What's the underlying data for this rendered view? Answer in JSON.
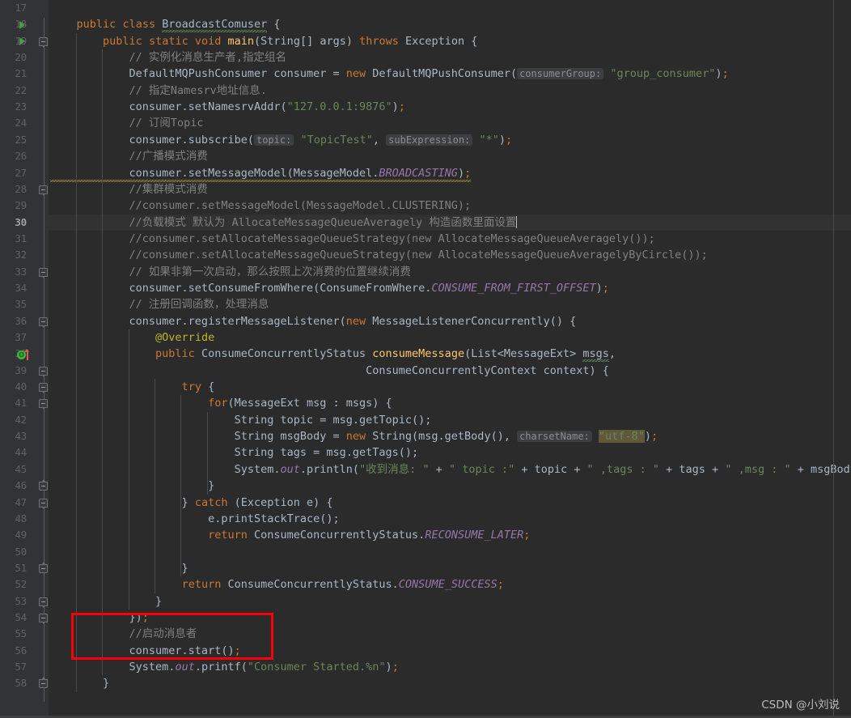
{
  "editor": {
    "theme": "darcula",
    "background": "#2b2b2b",
    "gutter_background": "#313335",
    "current_line_number": 30,
    "first_visible_line": 17,
    "last_visible_line": 58,
    "language": "Java",
    "caret_line": 30
  },
  "watermark": {
    "text": "CSDN @小刘说"
  },
  "annotation": {
    "color": "#fb0007",
    "covers_lines": "54-56",
    "label": "red-highlight-box"
  },
  "gutter": {
    "run_arrow_lines": [
      18,
      19
    ],
    "fold_start_lines": [
      19,
      28,
      33,
      36,
      39,
      40,
      41,
      47,
      53,
      54
    ],
    "fold_end_lines": [
      46,
      51,
      58
    ],
    "override_marker_lines": [
      38
    ],
    "override_marker_glyph": "O"
  },
  "lines": [
    {
      "n": 17,
      "tokens": []
    },
    {
      "n": 18,
      "tokens": [
        {
          "t": "    ",
          "c": "plain"
        },
        {
          "t": "public",
          "c": "kw"
        },
        {
          "t": " ",
          "c": "plain"
        },
        {
          "t": "class",
          "c": "kw"
        },
        {
          "t": " ",
          "c": "plain"
        },
        {
          "t": "BroadcastComuser",
          "c": "typo"
        },
        {
          "t": " {",
          "c": "plain"
        }
      ]
    },
    {
      "n": 19,
      "tokens": [
        {
          "t": "        ",
          "c": "plain"
        },
        {
          "t": "public",
          "c": "kw"
        },
        {
          "t": " ",
          "c": "plain"
        },
        {
          "t": "static",
          "c": "kw"
        },
        {
          "t": " ",
          "c": "plain"
        },
        {
          "t": "void",
          "c": "kw"
        },
        {
          "t": " ",
          "c": "plain"
        },
        {
          "t": "main",
          "c": "meth"
        },
        {
          "t": "(String[] args) ",
          "c": "plain"
        },
        {
          "t": "throws",
          "c": "kw"
        },
        {
          "t": " Exception {",
          "c": "plain"
        }
      ]
    },
    {
      "n": 20,
      "tokens": [
        {
          "t": "            // 实例化消息生产者,指定组名",
          "c": "cmt"
        }
      ]
    },
    {
      "n": 21,
      "tokens": [
        {
          "t": "            DefaultMQPushConsumer consumer = ",
          "c": "plain"
        },
        {
          "t": "new",
          "c": "kw"
        },
        {
          "t": " DefaultMQPushConsumer(",
          "c": "plain"
        },
        {
          "t": "consumerGroup:",
          "c": "hint"
        },
        {
          "t": " ",
          "c": "plain"
        },
        {
          "t": "\"group_consumer\"",
          "c": "str"
        },
        {
          "t": ")",
          "c": "plain"
        },
        {
          "t": ";",
          "c": "semi"
        }
      ]
    },
    {
      "n": 22,
      "tokens": [
        {
          "t": "            // 指定Namesrv地址信息.",
          "c": "cmt"
        }
      ]
    },
    {
      "n": 23,
      "tokens": [
        {
          "t": "            consumer.setNamesrvAddr(",
          "c": "plain"
        },
        {
          "t": "\"127.0.0.1:9876\"",
          "c": "str"
        },
        {
          "t": ")",
          "c": "plain"
        },
        {
          "t": ";",
          "c": "semi"
        }
      ]
    },
    {
      "n": 24,
      "tokens": [
        {
          "t": "            // 订阅Topic",
          "c": "cmt"
        }
      ]
    },
    {
      "n": 25,
      "tokens": [
        {
          "t": "            consumer.subscribe(",
          "c": "plain"
        },
        {
          "t": "topic:",
          "c": "hint"
        },
        {
          "t": " ",
          "c": "plain"
        },
        {
          "t": "\"TopicTest\"",
          "c": "str"
        },
        {
          "t": ", ",
          "c": "plain"
        },
        {
          "t": "subExpression:",
          "c": "hint"
        },
        {
          "t": " ",
          "c": "plain"
        },
        {
          "t": "\"*\"",
          "c": "str"
        },
        {
          "t": ")",
          "c": "plain"
        },
        {
          "t": ";",
          "c": "semi"
        }
      ]
    },
    {
      "n": 26,
      "tokens": [
        {
          "t": "            //广播模式消费",
          "c": "cmt"
        }
      ]
    },
    {
      "n": 27,
      "warn": true,
      "tokens": [
        {
          "t": "            consumer.setMessageModel(MessageModel.",
          "c": "plain"
        },
        {
          "t": "BROADCASTING",
          "c": "fld"
        },
        {
          "t": ")",
          "c": "plain"
        },
        {
          "t": ";",
          "c": "semi"
        }
      ]
    },
    {
      "n": 28,
      "tokens": [
        {
          "t": "            //集群模式消费",
          "c": "cmt"
        }
      ]
    },
    {
      "n": 29,
      "tokens": [
        {
          "t": "            //consumer.setMessageModel(MessageModel.CLUSTERING);",
          "c": "cmt"
        }
      ]
    },
    {
      "n": 30,
      "current": true,
      "caret": true,
      "tokens": [
        {
          "t": "            //负载模式 默认为 AllocateMessageQueueAveragely 构造函数里面设置",
          "c": "cmt"
        }
      ]
    },
    {
      "n": 31,
      "tokens": [
        {
          "t": "            //consumer.setAllocateMessageQueueStrategy(new AllocateMessageQueueAveragely());",
          "c": "cmt"
        }
      ]
    },
    {
      "n": 32,
      "tokens": [
        {
          "t": "            //consumer.setAllocateMessageQueueStrategy(new AllocateMessageQueueAveragelyByCircle());",
          "c": "cmt"
        }
      ]
    },
    {
      "n": 33,
      "tokens": [
        {
          "t": "            // 如果非第一次启动，那么按照上次消费的位置继续消费",
          "c": "cmt"
        }
      ]
    },
    {
      "n": 34,
      "tokens": [
        {
          "t": "            consumer.setConsumeFromWhere(ConsumeFromWhere.",
          "c": "plain"
        },
        {
          "t": "CONSUME_FROM_FIRST_OFFSET",
          "c": "fld"
        },
        {
          "t": ")",
          "c": "plain"
        },
        {
          "t": ";",
          "c": "semi"
        }
      ]
    },
    {
      "n": 35,
      "tokens": [
        {
          "t": "            // 注册回调函数，处理消息",
          "c": "cmt"
        }
      ]
    },
    {
      "n": 36,
      "tokens": [
        {
          "t": "            consumer.registerMessageListener(",
          "c": "plain"
        },
        {
          "t": "new",
          "c": "kw"
        },
        {
          "t": " MessageListenerConcurrently() {",
          "c": "plain"
        }
      ]
    },
    {
      "n": 37,
      "tokens": [
        {
          "t": "                ",
          "c": "plain"
        },
        {
          "t": "@Override",
          "c": "anno"
        }
      ]
    },
    {
      "n": 38,
      "tokens": [
        {
          "t": "                ",
          "c": "plain"
        },
        {
          "t": "public",
          "c": "kw"
        },
        {
          "t": " ConsumeConcurrentlyStatus ",
          "c": "plain"
        },
        {
          "t": "consumeMessage",
          "c": "meth"
        },
        {
          "t": "(List<MessageExt> ",
          "c": "plain"
        },
        {
          "t": "msgs",
          "c": "typo"
        },
        {
          "t": ",",
          "c": "plain"
        }
      ]
    },
    {
      "n": 39,
      "tokens": [
        {
          "t": "                                                ConsumeConcurrentlyContext context) {",
          "c": "plain"
        }
      ]
    },
    {
      "n": 40,
      "tokens": [
        {
          "t": "                    ",
          "c": "plain"
        },
        {
          "t": "try",
          "c": "kw"
        },
        {
          "t": " {",
          "c": "plain"
        }
      ]
    },
    {
      "n": 41,
      "tokens": [
        {
          "t": "                        ",
          "c": "plain"
        },
        {
          "t": "for",
          "c": "kw"
        },
        {
          "t": "(MessageExt msg : msgs) {",
          "c": "plain"
        }
      ]
    },
    {
      "n": 42,
      "tokens": [
        {
          "t": "                            String topic = msg.getTopic();",
          "c": "plain"
        }
      ]
    },
    {
      "n": 43,
      "tokens": [
        {
          "t": "                            String msgBody = ",
          "c": "plain"
        },
        {
          "t": "new",
          "c": "kw"
        },
        {
          "t": " String(msg.getBody(), ",
          "c": "plain"
        },
        {
          "t": "charsetName:",
          "c": "hint"
        },
        {
          "t": " ",
          "c": "plain"
        },
        {
          "t": "\"utf-8\"",
          "c": "str-sel"
        },
        {
          "t": ")",
          "c": "plain"
        },
        {
          "t": ";",
          "c": "semi"
        }
      ]
    },
    {
      "n": 44,
      "tokens": [
        {
          "t": "                            String tags = msg.getTags();",
          "c": "plain"
        }
      ]
    },
    {
      "n": 45,
      "tokens": [
        {
          "t": "                            System.",
          "c": "plain"
        },
        {
          "t": "out",
          "c": "fld"
        },
        {
          "t": ".println(",
          "c": "plain"
        },
        {
          "t": "\"收到消息: \"",
          "c": "str"
        },
        {
          "t": " + ",
          "c": "plain"
        },
        {
          "t": "\" topic :\"",
          "c": "str"
        },
        {
          "t": " + topic + ",
          "c": "plain"
        },
        {
          "t": "\" ,tags : \"",
          "c": "str"
        },
        {
          "t": " + tags + ",
          "c": "plain"
        },
        {
          "t": "\" ,msg : \"",
          "c": "str"
        },
        {
          "t": " + msgBody)",
          "c": "plain"
        },
        {
          "t": ";",
          "c": "semi"
        }
      ]
    },
    {
      "n": 46,
      "tokens": [
        {
          "t": "                        }",
          "c": "plain"
        }
      ]
    },
    {
      "n": 47,
      "tokens": [
        {
          "t": "                    } ",
          "c": "plain"
        },
        {
          "t": "catch",
          "c": "kw"
        },
        {
          "t": " (Exception e) {",
          "c": "plain"
        }
      ]
    },
    {
      "n": 48,
      "tokens": [
        {
          "t": "                        e.printStackTrace();",
          "c": "plain"
        }
      ]
    },
    {
      "n": 49,
      "tokens": [
        {
          "t": "                        ",
          "c": "plain"
        },
        {
          "t": "return",
          "c": "kw"
        },
        {
          "t": " ConsumeConcurrentlyStatus.",
          "c": "plain"
        },
        {
          "t": "RECONSUME_LATER",
          "c": "fld"
        },
        {
          "t": ";",
          "c": "semi"
        }
      ]
    },
    {
      "n": 50,
      "tokens": []
    },
    {
      "n": 51,
      "tokens": [
        {
          "t": "                    }",
          "c": "plain"
        }
      ]
    },
    {
      "n": 52,
      "tokens": [
        {
          "t": "                    ",
          "c": "plain"
        },
        {
          "t": "return",
          "c": "kw"
        },
        {
          "t": " ConsumeConcurrentlyStatus.",
          "c": "plain"
        },
        {
          "t": "CONSUME_SUCCESS",
          "c": "fld"
        },
        {
          "t": ";",
          "c": "semi"
        }
      ]
    },
    {
      "n": 53,
      "tokens": [
        {
          "t": "                }",
          "c": "plain"
        }
      ]
    },
    {
      "n": 54,
      "tokens": [
        {
          "t": "            })",
          "c": "plain"
        },
        {
          "t": ";",
          "c": "semi"
        }
      ]
    },
    {
      "n": 55,
      "tokens": [
        {
          "t": "            //启动消息者",
          "c": "cmt"
        }
      ]
    },
    {
      "n": 56,
      "tokens": [
        {
          "t": "            consumer.start()",
          "c": "plain"
        },
        {
          "t": ";",
          "c": "semi"
        }
      ]
    },
    {
      "n": 57,
      "tokens": [
        {
          "t": "            System.",
          "c": "plain"
        },
        {
          "t": "out",
          "c": "fld"
        },
        {
          "t": ".printf(",
          "c": "plain"
        },
        {
          "t": "\"Consumer Started.%n\"",
          "c": "str"
        },
        {
          "t": ")",
          "c": "plain"
        },
        {
          "t": ";",
          "c": "semi"
        }
      ]
    },
    {
      "n": 58,
      "tokens": [
        {
          "t": "        }",
          "c": "plain"
        }
      ]
    }
  ]
}
